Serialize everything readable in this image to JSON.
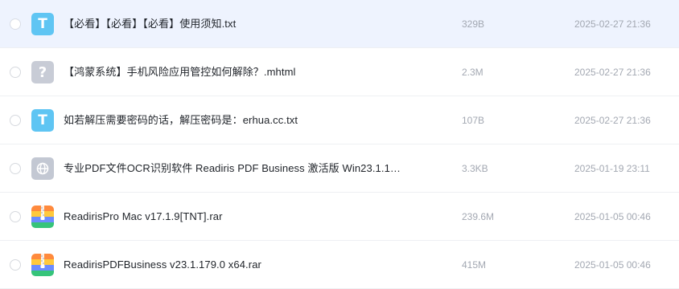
{
  "files": [
    {
      "name": "【必看】【必看】【必看】使用须知.txt",
      "size": "329B",
      "date": "2025-02-27 21:36",
      "icon": "txt-file-icon",
      "icon_glyph": "T",
      "selected": true
    },
    {
      "name": "【鸿蒙系统】手机风险应用管控如何解除？.mhtml",
      "size": "2.3M",
      "date": "2025-02-27 21:36",
      "icon": "unknown-file-icon",
      "icon_glyph": "?"
    },
    {
      "name": "如若解压需要密码的话，解压密码是：erhua.cc.txt",
      "size": "107B",
      "date": "2025-02-27 21:36",
      "icon": "txt-file-icon",
      "icon_glyph": "T"
    },
    {
      "name": "专业PDF文件OCR识别软件 Readiris PDF Business 激活版 Win23.1.1…",
      "size": "3.3KB",
      "date": "2025-01-19 23:11",
      "icon": "web-link-icon"
    },
    {
      "name": "ReadirisPro Mac v17.1.9[TNT].rar",
      "size": "239.6M",
      "date": "2025-01-05 00:46",
      "icon": "archive-file-icon"
    },
    {
      "name": "ReadirisPDFBusiness v23.1.179.0 x64.rar",
      "size": "415M",
      "date": "2025-01-05 00:46",
      "icon": "archive-file-icon"
    }
  ],
  "colors": {
    "selected_row_bg": "#eef3fe",
    "txt_icon": "#5fc5f3",
    "unknown_icon": "#c8ccd6",
    "meta_text": "#a3a8b2"
  }
}
